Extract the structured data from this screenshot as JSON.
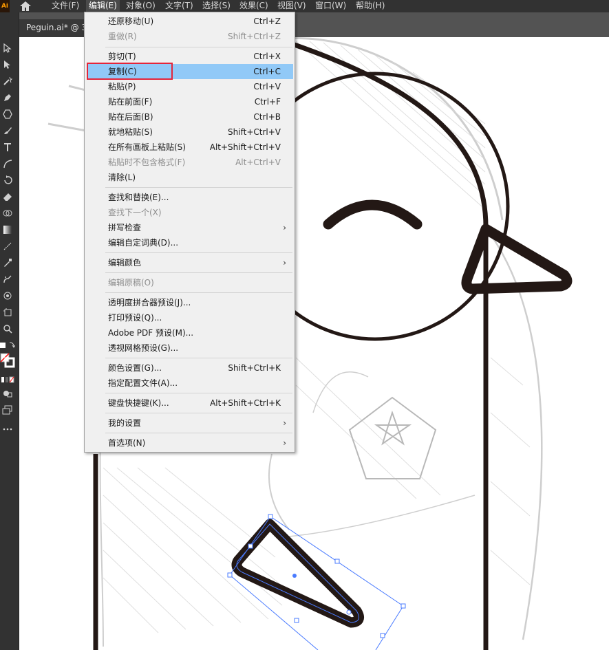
{
  "app": {
    "logo_text": "Ai",
    "brand_color": "#ff9a00"
  },
  "menubar": {
    "items": [
      {
        "label": "文件(F)"
      },
      {
        "label": "编辑(E)"
      },
      {
        "label": "对象(O)"
      },
      {
        "label": "文字(T)"
      },
      {
        "label": "选择(S)"
      },
      {
        "label": "效果(C)"
      },
      {
        "label": "视图(V)"
      },
      {
        "label": "窗口(W)"
      },
      {
        "label": "帮助(H)"
      }
    ],
    "active_item": "编辑(E)"
  },
  "document_tab": {
    "label": "Peguin.ai* @ 3"
  },
  "edit_menu": {
    "items": [
      {
        "label": "还原移动(U)",
        "shortcut": "Ctrl+Z",
        "state": "enabled"
      },
      {
        "label": "重做(R)",
        "shortcut": "Shift+Ctrl+Z",
        "state": "disabled"
      },
      {
        "label": "剪切(T)",
        "shortcut": "Ctrl+X",
        "state": "enabled"
      },
      {
        "label": "复制(C)",
        "shortcut": "Ctrl+C",
        "state": "highlighted"
      },
      {
        "label": "粘贴(P)",
        "shortcut": "Ctrl+V",
        "state": "enabled"
      },
      {
        "label": "贴在前面(F)",
        "shortcut": "Ctrl+F",
        "state": "enabled"
      },
      {
        "label": "贴在后面(B)",
        "shortcut": "Ctrl+B",
        "state": "enabled"
      },
      {
        "label": "就地粘贴(S)",
        "shortcut": "Shift+Ctrl+V",
        "state": "enabled"
      },
      {
        "label": "在所有画板上粘贴(S)",
        "shortcut": "Alt+Shift+Ctrl+V",
        "state": "enabled"
      },
      {
        "label": "粘贴时不包含格式(F)",
        "shortcut": "Alt+Ctrl+V",
        "state": "disabled"
      },
      {
        "label": "清除(L)",
        "shortcut": "",
        "state": "enabled"
      },
      {
        "label": "查找和替换(E)...",
        "shortcut": "",
        "state": "enabled"
      },
      {
        "label": "查找下一个(X)",
        "shortcut": "",
        "state": "disabled"
      },
      {
        "label": "拼写检查",
        "shortcut": "",
        "state": "enabled",
        "submenu": true
      },
      {
        "label": "编辑自定词典(D)...",
        "shortcut": "",
        "state": "enabled"
      },
      {
        "label": "编辑颜色",
        "shortcut": "",
        "state": "enabled",
        "submenu": true
      },
      {
        "label": "编辑原稿(O)",
        "shortcut": "",
        "state": "disabled"
      },
      {
        "label": "透明度拼合器预设(J)...",
        "shortcut": "",
        "state": "enabled"
      },
      {
        "label": "打印预设(Q)...",
        "shortcut": "",
        "state": "enabled"
      },
      {
        "label": "Adobe PDF 预设(M)...",
        "shortcut": "",
        "state": "enabled"
      },
      {
        "label": "透视网格预设(G)...",
        "shortcut": "",
        "state": "enabled"
      },
      {
        "label": "颜色设置(G)...",
        "shortcut": "Shift+Ctrl+K",
        "state": "enabled"
      },
      {
        "label": "指定配置文件(A)...",
        "shortcut": "",
        "state": "enabled"
      },
      {
        "label": "键盘快捷键(K)...",
        "shortcut": "Alt+Shift+Ctrl+K",
        "state": "enabled"
      },
      {
        "label": "我的设置",
        "shortcut": "",
        "state": "enabled",
        "submenu": true
      },
      {
        "label": "首选项(N)",
        "shortcut": "",
        "state": "enabled",
        "submenu": true
      }
    ],
    "highlight_color": "#91c9f7",
    "focus_outline_color": "#e4253a"
  },
  "toolbar": {
    "tools": [
      {
        "icon": "selection-tool-icon"
      },
      {
        "icon": "direct-selection-tool-icon"
      },
      {
        "icon": "magic-wand-tool-icon"
      },
      {
        "icon": "pen-tool-icon"
      },
      {
        "icon": "shape-tool-icon"
      },
      {
        "icon": "paintbrush-tool-icon"
      },
      {
        "icon": "type-tool-icon"
      },
      {
        "icon": "line-tool-icon"
      },
      {
        "icon": "rotate-tool-icon"
      },
      {
        "icon": "eraser-tool-icon"
      },
      {
        "icon": "shape-builder-tool-icon"
      },
      {
        "icon": "gradient-tool-icon"
      },
      {
        "icon": "eyedropper-tool-icon"
      },
      {
        "icon": "blend-tool-icon"
      },
      {
        "icon": "symbol-sprayer-tool-icon"
      },
      {
        "icon": "artboard-tool-icon"
      },
      {
        "icon": "zoom-tool-icon"
      }
    ]
  }
}
